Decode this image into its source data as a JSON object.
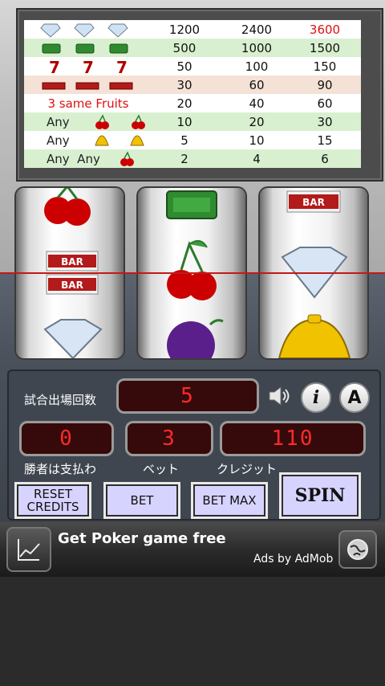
{
  "paytable": {
    "rows": [
      {
        "symbols": "diamond diamond diamond",
        "values": [
          "1200",
          "2400",
          "3600"
        ]
      },
      {
        "symbols": "cash cash cash",
        "values": [
          "500",
          "1000",
          "1500"
        ]
      },
      {
        "symbols": "seven seven seven",
        "values": [
          "50",
          "100",
          "150"
        ]
      },
      {
        "symbols": "bar bar bar",
        "values": [
          "30",
          "60",
          "90"
        ]
      },
      {
        "symbols_text": "3 same Fruits",
        "values": [
          "20",
          "40",
          "60"
        ]
      },
      {
        "symbols_text": "Any",
        "icon": "cherry-icon",
        "values": [
          "10",
          "20",
          "30"
        ]
      },
      {
        "symbols_text": "Any",
        "icon": "bell-icon",
        "values": [
          "5",
          "10",
          "15"
        ]
      },
      {
        "symbols_text": "Any  Any",
        "icon": "cherry-icon",
        "values": [
          "2",
          "4",
          "6"
        ]
      }
    ],
    "bar_text": "BAR"
  },
  "reels": {
    "reel1": [
      "cherry",
      "bar",
      "bar",
      "diamond"
    ],
    "reel2": [
      "cash",
      "cherry",
      "plum"
    ],
    "reel3": [
      "bar",
      "diamond",
      "bell"
    ]
  },
  "panel": {
    "rounds_label": "試合出場回数",
    "rounds_value": "5",
    "win_label": "勝者は支払わ",
    "win_value": "0",
    "bet_label": "ベット",
    "bet_value": "3",
    "credit_label": "クレジット",
    "credit_value": "110",
    "info_label": "i",
    "auto_label": "A",
    "buttons": {
      "reset": "RESET\nCREDITS",
      "bet": "BET",
      "bet_max": "BET MAX",
      "spin": "SPIN"
    }
  },
  "ad": {
    "title": "Get Poker game free",
    "subtitle": "Ads by AdMob"
  },
  "colors": {
    "led_red": "#ff2a2a",
    "button_face": "#d7d3ff",
    "payline": "#c31919"
  }
}
